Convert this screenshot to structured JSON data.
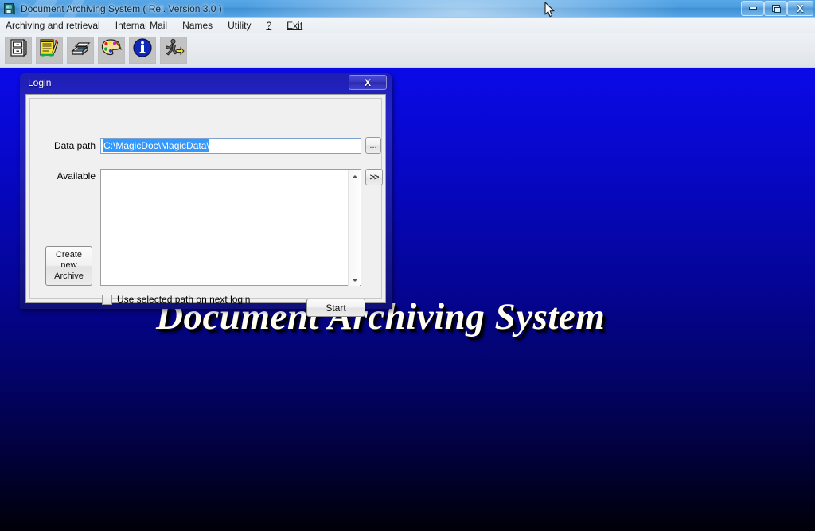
{
  "window": {
    "title": "Document Archiving System ( Rel. Version 3.0 )",
    "app_icon": "floppy-disk-icon",
    "controls": {
      "minimize": "minimize-icon",
      "restore": "restore-icon",
      "close": "X"
    }
  },
  "menubar": {
    "items": [
      {
        "label": "Archiving and retrieval"
      },
      {
        "label": "Internal Mail"
      },
      {
        "label": "Names"
      },
      {
        "label": "Utility"
      },
      {
        "label": "?"
      },
      {
        "label": "Exit"
      }
    ]
  },
  "toolbar": {
    "buttons": [
      {
        "icon": "filing-cabinet-icon",
        "name": "archiving-retrieval"
      },
      {
        "icon": "notepad-pencil-icon",
        "name": "new-document"
      },
      {
        "icon": "scanner-icon",
        "name": "scan"
      },
      {
        "icon": "palette-icon",
        "name": "appearance"
      },
      {
        "icon": "info-circle-icon",
        "name": "about"
      },
      {
        "icon": "exit-running-man-icon",
        "name": "exit"
      }
    ]
  },
  "desktop": {
    "background_title": "Document Archiving System",
    "gradient_top": "#0a0ae8",
    "gradient_bottom": "#000008"
  },
  "dialog": {
    "title": "Login",
    "close_label": "X",
    "fields": {
      "data_path_label": "Data path",
      "data_path_value": "C:\\MagicDoc\\MagicData\\",
      "data_path_placeholder": "",
      "browse_label": "...",
      "available_label": "Available",
      "move_label": ">>",
      "available_items": []
    },
    "buttons": {
      "create_new_archive_line1": "Create",
      "create_new_archive_line2": "new",
      "create_new_archive_line3": "Archive",
      "start_label": "Start"
    },
    "checkbox": {
      "label": "Use selected path on next login",
      "checked": false
    },
    "selection_color": "#3399ff"
  }
}
